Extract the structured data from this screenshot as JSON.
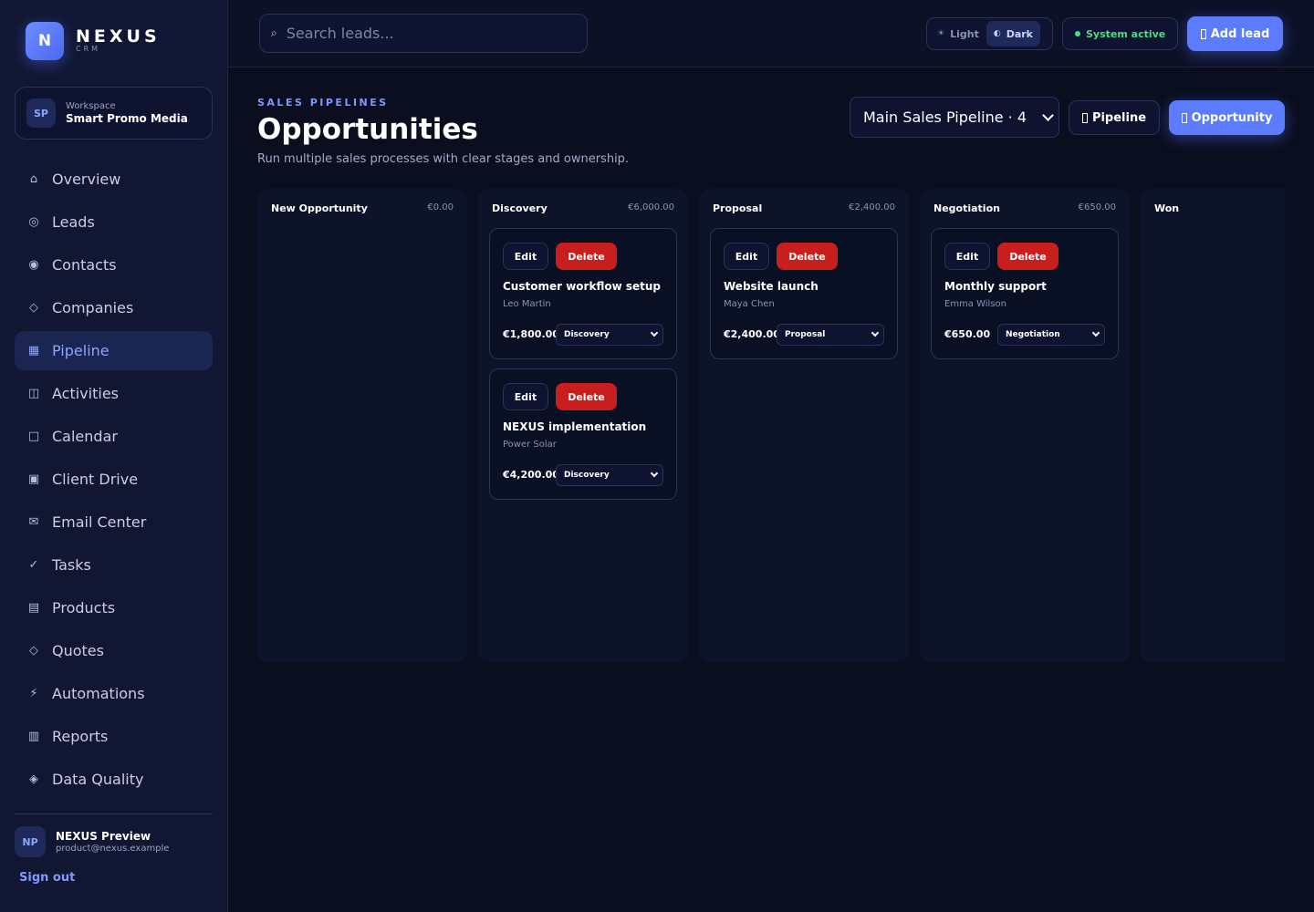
{
  "brand": {
    "logo_letter": "N",
    "name": "NEXUS",
    "sub": "CRM"
  },
  "workspace": {
    "badge": "SP",
    "label": "Workspace",
    "name": "Smart Promo Media"
  },
  "nav": [
    {
      "label": "Overview",
      "icon": "⌂",
      "icon_name": "home-icon"
    },
    {
      "label": "Leads",
      "icon": "◎",
      "icon_name": "target-icon"
    },
    {
      "label": "Contacts",
      "icon": "◉",
      "icon_name": "contact-icon"
    },
    {
      "label": "Companies",
      "icon": "◇",
      "icon_name": "diamond-icon"
    },
    {
      "label": "Pipeline",
      "icon": "▦",
      "icon_name": "pipeline-icon",
      "active": true
    },
    {
      "label": "Activities",
      "icon": "◫",
      "icon_name": "activity-icon"
    },
    {
      "label": "Calendar",
      "icon": "□",
      "icon_name": "calendar-icon"
    },
    {
      "label": "Client Drive",
      "icon": "▣",
      "icon_name": "drive-icon"
    },
    {
      "label": "Email Center",
      "icon": "✉",
      "icon_name": "email-icon"
    },
    {
      "label": "Tasks",
      "icon": "✓",
      "icon_name": "check-icon"
    },
    {
      "label": "Products",
      "icon": "▤",
      "icon_name": "products-icon"
    },
    {
      "label": "Quotes",
      "icon": "◇",
      "icon_name": "quote-icon"
    },
    {
      "label": "Automations",
      "icon": "⚡",
      "icon_name": "lightning-icon"
    },
    {
      "label": "Reports",
      "icon": "▥",
      "icon_name": "reports-icon"
    },
    {
      "label": "Data Quality",
      "icon": "◈",
      "icon_name": "quality-icon"
    }
  ],
  "user": {
    "badge": "NP",
    "name": "NEXUS Preview",
    "email": "product@nexus.example",
    "signout": "Sign out"
  },
  "topbar": {
    "search_placeholder": "Search leads...",
    "theme_light": "Light",
    "theme_dark": "Dark",
    "status": "System active",
    "add_lead": "Add lead"
  },
  "header": {
    "eyebrow": "SALES PIPELINES",
    "title": "Opportunities",
    "subtitle": "Run multiple sales processes with clear stages and ownership.",
    "pipeline_selected": "Main Sales Pipeline · 4",
    "pipeline_button": "Pipeline",
    "opportunity_button": "Opportunity"
  },
  "colors": {
    "accent": "#5b7cff",
    "danger": "#c81e1e",
    "success": "#4ade80",
    "bg": "#0a0e1e"
  },
  "columns": [
    {
      "name": "New Opportunity",
      "total": "€0.00",
      "cards": []
    },
    {
      "name": "Discovery",
      "total": "€6,000.00",
      "cards": [
        {
          "title": "Customer workflow setup",
          "owner": "Leo Martin",
          "amount": "€1,800.00",
          "stage": "Discovery"
        },
        {
          "title": "NEXUS implementation",
          "owner": "Power Solar",
          "amount": "€4,200.00",
          "stage": "Discovery"
        }
      ]
    },
    {
      "name": "Proposal",
      "total": "€2,400.00",
      "cards": [
        {
          "title": "Website launch",
          "owner": "Maya Chen",
          "amount": "€2,400.00",
          "stage": "Proposal"
        }
      ]
    },
    {
      "name": "Negotiation",
      "total": "€650.00",
      "cards": [
        {
          "title": "Monthly support",
          "owner": "Emma Wilson",
          "amount": "€650.00",
          "stage": "Negotiation"
        }
      ]
    },
    {
      "name": "Won",
      "total": "",
      "cards": []
    }
  ],
  "card_labels": {
    "edit": "Edit",
    "delete": "Delete"
  }
}
